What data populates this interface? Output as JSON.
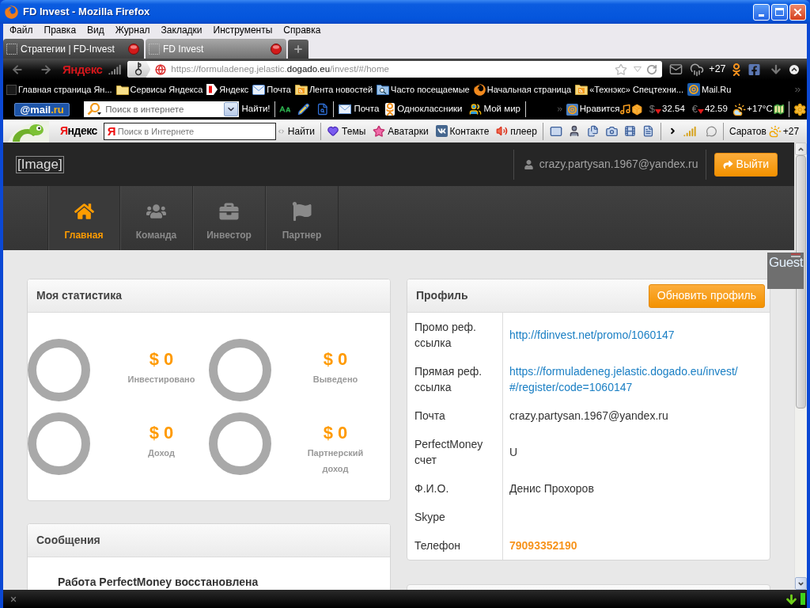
{
  "window": {
    "title": "FD Invest - Mozilla Firefox"
  },
  "menu": [
    "Файл",
    "Правка",
    "Вид",
    "Журнал",
    "Закладки",
    "Инструменты",
    "Справка"
  ],
  "tabs": [
    {
      "label": "Стратегии | FD-Invest",
      "selected": false
    },
    {
      "label": "FD Invest",
      "selected": true
    }
  ],
  "nav_toolbar": {
    "logo": "Яндекс",
    "url": [
      {
        "text": "https://formuladeneg.jelastic.",
        "emphasized": false
      },
      {
        "text": "dogado.eu",
        "emphasized": true
      },
      {
        "text": "/invest/#/home",
        "emphasized": false
      }
    ],
    "weather": "+27"
  },
  "bookmarks": [
    {
      "label": "Главная страница Ян...",
      "kind": "page"
    },
    {
      "label": "Сервисы Яндекса",
      "kind": "folder"
    },
    {
      "label": "Яндекс",
      "kind": "yandex"
    },
    {
      "label": "Почта",
      "kind": "mail"
    },
    {
      "label": "Лента новостей",
      "kind": "feed"
    },
    {
      "label": "Часто посещаемые",
      "kind": "search-folder"
    },
    {
      "label": "Начальная страница",
      "kind": "firefox"
    },
    {
      "label": "«Технэкс» Спецтехни...",
      "kind": "feed"
    },
    {
      "label": "Mail.Ru",
      "kind": "at"
    }
  ],
  "mailru_bar": {
    "logo": [
      {
        "text": "@mail",
        "accent": false
      },
      {
        "text": ".ru",
        "accent": true
      }
    ],
    "search_placeholder": "Поиск в интернете",
    "search_button": "Найти!",
    "links": [
      {
        "label": "Почта",
        "kind": "mail"
      },
      {
        "label": "Одноклассники",
        "kind": "ok"
      },
      {
        "label": "Мой мир",
        "kind": "world"
      }
    ],
    "like": "Нравится",
    "rates": [
      {
        "symbol": "$",
        "value": "32.54",
        "falling": true
      },
      {
        "symbol": "€",
        "value": "42.59",
        "falling": true
      }
    ],
    "weather": "+17°C"
  },
  "yandex_bar": {
    "logo": "Яндекс",
    "search_mark": "Я",
    "search_placeholder": "Поиск в Интернете",
    "search_button": "Найти",
    "links": [
      {
        "label": "Темы",
        "kind": "heart"
      },
      {
        "label": "Аватарки",
        "kind": "star"
      },
      {
        "label": "Контакте",
        "kind": "vk"
      },
      {
        "label": "плеер",
        "kind": "speaker"
      }
    ],
    "city": "Саратов",
    "weather": "+27"
  },
  "header": {
    "logo_alt": "[Image]",
    "user_email": "crazy.partysan.1967@yandex.ru",
    "logout": "Выйти"
  },
  "nav": [
    {
      "label": "Главная",
      "kind": "home",
      "selected": true
    },
    {
      "label": "Команда",
      "kind": "team",
      "selected": false
    },
    {
      "label": "Инвестор",
      "kind": "investor",
      "selected": false
    },
    {
      "label": "Партнер",
      "kind": "partner",
      "selected": false
    }
  ],
  "stats": {
    "title": "Моя статистика",
    "items": [
      {
        "value": "$ 0",
        "label": "Инвестировано"
      },
      {
        "value": "$ 0",
        "label": "Выведено"
      },
      {
        "value": "$ 0",
        "label": "Доход"
      },
      {
        "value": "$ 0",
        "label": "Партнерский доход"
      }
    ]
  },
  "messages": {
    "title": "Сообщения",
    "items": [
      "Работа PerfectMoney восстановлена"
    ]
  },
  "profile": {
    "title": "Профиль",
    "button": "Обновить профиль",
    "rows": [
      {
        "label": "Промо реф. ссылка",
        "value": "http://fdinvest.net/promo/1060147",
        "kind": "link"
      },
      {
        "label": "Прямая реф. ссылка",
        "value": "https://formuladeneg.jelastic.dogado.eu/invest/#/register/code=1060147",
        "kind": "link"
      },
      {
        "label": "Почта",
        "value": "crazy.partysan.1967@yandex.ru",
        "kind": "text"
      },
      {
        "label": "PerfectMoney счет",
        "value": "U",
        "kind": "text"
      },
      {
        "label": "Ф.И.О.",
        "value": "Денис Прохоров",
        "kind": "text"
      },
      {
        "label": "Skype"
      },
      {
        "label": "Телефон",
        "value": "79093352190",
        "kind": "phone"
      }
    ]
  },
  "guest_badge": "Guest"
}
